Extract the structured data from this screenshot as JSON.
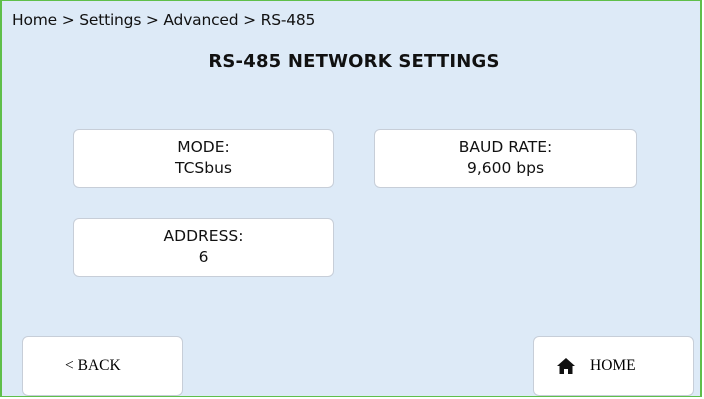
{
  "breadcrumb": "Home > Settings > Advanced > RS-485",
  "title": "RS-485 NETWORK SETTINGS",
  "mode": {
    "label": "MODE:",
    "value": "TCSbus"
  },
  "baud_rate": {
    "label": "BAUD RATE:",
    "value": "9,600 bps"
  },
  "address": {
    "label": "ADDRESS:",
    "value": "6"
  },
  "buttons": {
    "back": "< BACK",
    "home": "HOME"
  },
  "colors": {
    "background": "#ddeaf7",
    "frame": "#5fbf4a",
    "button": "#ffffff"
  },
  "icons": {
    "home": "home-icon"
  }
}
